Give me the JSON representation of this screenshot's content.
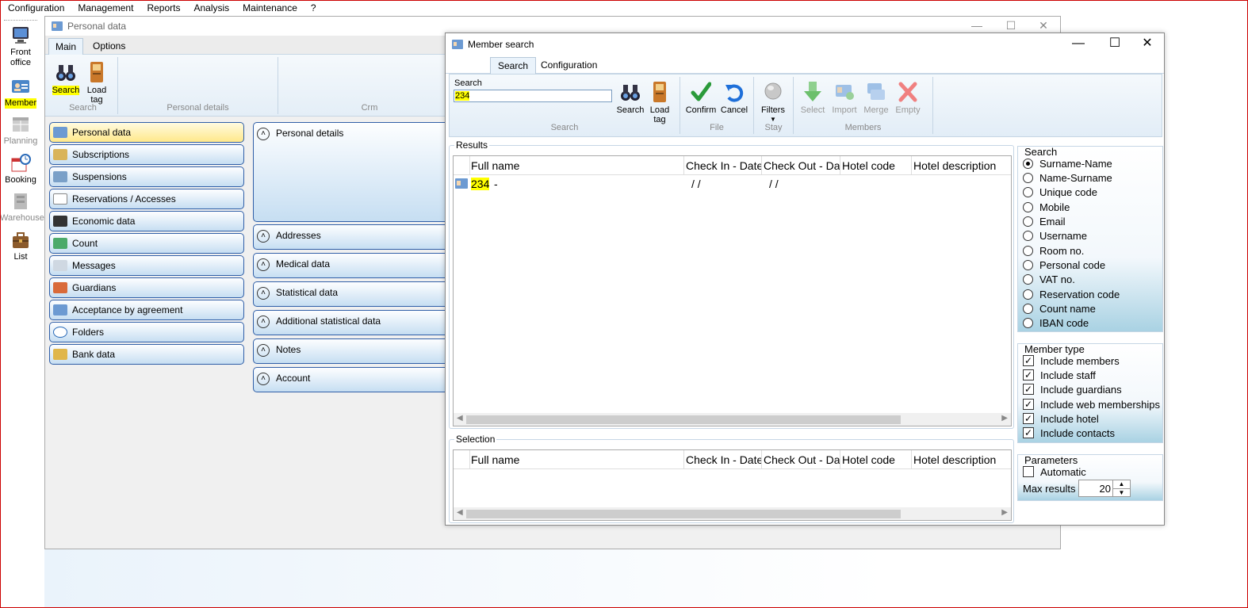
{
  "menu": [
    "Configuration",
    "Management",
    "Reports",
    "Analysis",
    "Maintenance",
    "?"
  ],
  "sidebar": {
    "items": [
      {
        "label": "Front office",
        "icon": "monitor-icon"
      },
      {
        "label": "Member",
        "icon": "member-card-icon",
        "selected": true
      },
      {
        "label": "Planning",
        "icon": "planning-icon",
        "disabled": true
      },
      {
        "label": "Booking",
        "icon": "booking-icon"
      },
      {
        "label": "Warehouse",
        "icon": "warehouse-icon",
        "disabled": true
      },
      {
        "label": "List",
        "icon": "briefcase-icon"
      }
    ]
  },
  "personal_window": {
    "title": "Personal data",
    "tabs": [
      "Main",
      "Options"
    ],
    "ribbon": {
      "search_label": "Search",
      "load_tag_label": "Load tag",
      "groups": [
        "Search",
        "Personal details",
        "Crm"
      ]
    },
    "nav": [
      "Personal data",
      "Subscriptions",
      "Suspensions",
      "Reservations / Accesses",
      "Economic data",
      "Count",
      "Messages",
      "Guardians",
      "Acceptance by agreement",
      "Folders",
      "Bank data"
    ],
    "sections": [
      "Personal details",
      "Addresses",
      "Medical data",
      "Statistical data",
      "Additional statistical data",
      "Notes",
      "Account"
    ]
  },
  "member_search": {
    "title": "Member search",
    "tabs": [
      "Search",
      "Configuration"
    ],
    "ribbon": {
      "search_caption": "Search",
      "search_value": "234",
      "buttons": {
        "search": "Search",
        "load_tag": "Load tag",
        "confirm": "Confirm",
        "cancel": "Cancel",
        "filters": "Filters",
        "select": "Select",
        "import": "Import",
        "merge": "Merge",
        "empty": "Empty"
      },
      "groups": {
        "search": "Search",
        "file": "File",
        "stay": "Stay",
        "members": "Members"
      }
    },
    "results": {
      "label": "Results",
      "columns": [
        "Full name",
        "Check In - Date",
        "Check Out - Date",
        "Hotel code",
        "Hotel description"
      ],
      "rows": [
        {
          "name": "234",
          "suffix": "-",
          "check_in": "/ /",
          "check_out": "/ /"
        }
      ]
    },
    "selection": {
      "label": "Selection",
      "columns": [
        "Full name",
        "Check In - Date",
        "Check Out - Date",
        "Hotel code",
        "Hotel description"
      ]
    },
    "search_panel": {
      "title": "Search",
      "options": [
        "Surname-Name",
        "Name-Surname",
        "Unique code",
        "Mobile",
        "Email",
        "Username",
        "Room no.",
        "Personal code",
        "VAT no.",
        "Reservation code",
        "Count name",
        "IBAN code"
      ],
      "selected": "Surname-Name"
    },
    "member_type": {
      "title": "Member type",
      "options": [
        "Include members",
        "Include staff",
        "Include guardians",
        "Include web memberships",
        "Include hotel",
        "Include contacts"
      ]
    },
    "parameters": {
      "title": "Parameters",
      "automatic_label": "Automatic",
      "max_results_label": "Max results",
      "max_results": "20"
    }
  },
  "colors": {
    "highlight": "#ffff00",
    "border_blue": "#2f5ea7",
    "accent": "#1e6fd9"
  }
}
